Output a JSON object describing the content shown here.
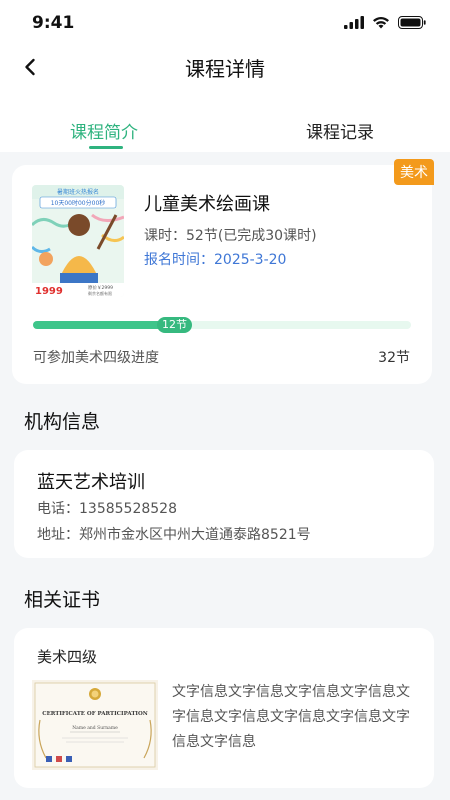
{
  "status_bar": {
    "time": "9:41"
  },
  "nav": {
    "title": "课程详情"
  },
  "tabs": [
    {
      "label": "课程简介",
      "active": true
    },
    {
      "label": "课程记录",
      "active": false
    }
  ],
  "course": {
    "tag": "美术",
    "name": "儿童美术绘画课",
    "hours": "课时：52节(已完成30课时)",
    "signup": "报名时间：2025-3-20",
    "cover": {
      "banner_top": "暑期班火热报名",
      "countdown": "10天00时00分00秒",
      "price": "1999",
      "original_price": "原价￥2999",
      "note": "剩余名额有限"
    },
    "progress": {
      "done": 12,
      "total": 32,
      "bubble": "12节",
      "label": "可参加美术四级进度",
      "total_label": "32节"
    }
  },
  "org": {
    "section_title": "机构信息",
    "name": "蓝天艺术培训",
    "phone": "电话：13585528528",
    "address": "地址：郑州市金水区中州大道通泰路8521号"
  },
  "cert": {
    "section_title": "相关证书",
    "name": "美术四级",
    "image_title": "CERTIFICATE OF PARTICIPATION",
    "image_sub": "Name and Surname",
    "description": "文字信息文字信息文字信息文字信息文字信息文字信息文字信息文字信息文字信息文字信息"
  },
  "colors": {
    "accent": "#2fb37f",
    "tag": "#f39a1c",
    "link": "#3f77d6",
    "background": "#f4f6f8"
  },
  "icons": {
    "back": "chevron-left-icon",
    "signal": "signal-icon",
    "wifi": "wifi-icon",
    "battery": "battery-icon"
  }
}
